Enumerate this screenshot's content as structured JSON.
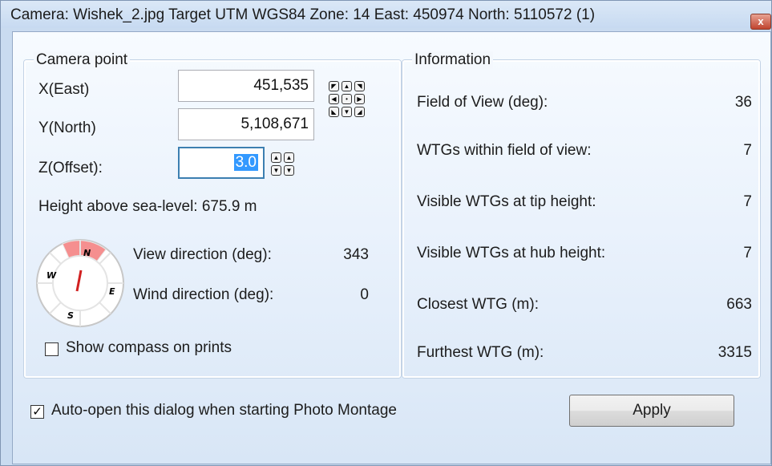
{
  "window": {
    "title": "Camera: Wishek_2.jpg  Target UTM WGS84 Zone: 14  East: 450974  North: 5110572 (1)",
    "close_glyph": "x"
  },
  "camera_point": {
    "title": "Camera point",
    "x_label": "X(East)",
    "x_value": "451,535",
    "y_label": "Y(North)",
    "y_value": "5,108,671",
    "z_label": "Z(Offset):",
    "z_value": "3.0",
    "height_text": "Height above sea-level: 675.9 m",
    "view_dir_label": "View direction (deg):",
    "view_dir_value": "343",
    "wind_dir_label": "Wind direction (deg):",
    "wind_dir_value": "0",
    "show_compass_label": "Show compass on prints",
    "show_compass_checked": false,
    "compass_letters": {
      "n": "N",
      "e": "E",
      "s": "S",
      "w": "W"
    }
  },
  "information": {
    "title": "Information",
    "rows": [
      {
        "label": "Field of View (deg):",
        "value": "36"
      },
      {
        "label": "WTGs within field of view:",
        "value": "7"
      },
      {
        "label": "Visible WTGs at tip height:",
        "value": "7"
      },
      {
        "label": "Visible WTGs at hub height:",
        "value": "7"
      },
      {
        "label": "Closest WTG (m):",
        "value": "663"
      },
      {
        "label": "Furthest WTG (m):",
        "value": "3315"
      }
    ]
  },
  "footer": {
    "auto_open_label": "Auto-open this dialog when starting Photo Montage",
    "auto_open_checked": true,
    "checkmark": "✓",
    "apply_label": "Apply"
  },
  "icons": {
    "pan_arrows": [
      "◤",
      "▲",
      "◥",
      "◀",
      "•",
      "▶",
      "◣",
      "▼",
      "◢"
    ],
    "z_spin": [
      "▲",
      "▲",
      "▼",
      "▼"
    ]
  }
}
